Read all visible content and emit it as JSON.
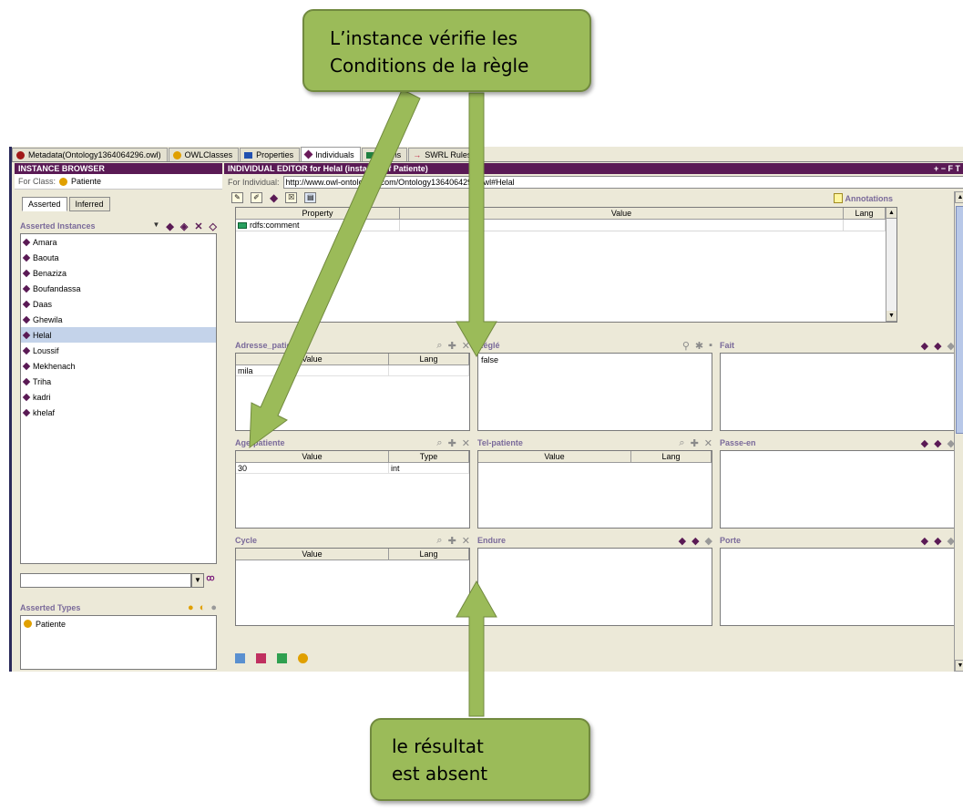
{
  "tabs": [
    {
      "label": "Metadata(Ontology1364064296.owl)",
      "color": "#a01818",
      "shape": "dot"
    },
    {
      "label": "OWLClasses",
      "color": "#e0a000",
      "shape": "dot"
    },
    {
      "label": "Properties",
      "color": "#2050b0",
      "shape": "square"
    },
    {
      "label": "Individuals",
      "color": "#5a1a55",
      "shape": "diamond",
      "active": true
    },
    {
      "label": "Forms",
      "color": "#208040",
      "shape": "square"
    },
    {
      "label": "SWRL Rules",
      "color": "#c02040",
      "shape": "arrow"
    }
  ],
  "instance_browser": {
    "title": "INSTANCE BROWSER",
    "for_class_label": "For Class:",
    "for_class_value": "Patiente",
    "subtabs": [
      "Asserted",
      "Inferred"
    ],
    "asserted_instances_label": "Asserted Instances",
    "instances": [
      "Amara",
      "Baouta",
      "Benaziza",
      "Boufandassa",
      "Daas",
      "Ghewila",
      "Helal",
      "Loussif",
      "Mekhenach",
      "Triha",
      "kadri",
      "khelaf"
    ],
    "selected_instance": "Helal",
    "asserted_types_label": "Asserted Types",
    "types": [
      "Patiente"
    ]
  },
  "editor": {
    "title": "INDIVIDUAL EDITOR for Helal  (instance of Patiente)",
    "title_controls": "+ − F T",
    "for_individual_label": "For Individual:",
    "for_individual_value": "http://www.owl-ontologies.com/Ontology1364064296.owl#Helal",
    "annotations_label": "Annotations",
    "prop_headers": [
      "Property",
      "Value",
      "Lang"
    ],
    "prop_rows": [
      {
        "property": "rdfs:comment",
        "value": "",
        "lang": ""
      }
    ]
  },
  "props": {
    "adresse": {
      "name": "Adresse_patiente",
      "headers": [
        "Value",
        "Lang"
      ],
      "rows": [
        [
          "mila",
          ""
        ]
      ]
    },
    "regle": {
      "name": "Réglé",
      "value": "false"
    },
    "fait": {
      "name": "Fait"
    },
    "age": {
      "name": "Age-patiente",
      "headers": [
        "Value",
        "Type"
      ],
      "rows": [
        [
          "30",
          "int"
        ]
      ]
    },
    "tel": {
      "name": "Tel-patiente",
      "headers": [
        "Value",
        "Lang"
      ]
    },
    "passe": {
      "name": "Passe-en"
    },
    "cycle": {
      "name": "Cycle",
      "headers": [
        "Value",
        "Lang"
      ]
    },
    "endure": {
      "name": "Endure"
    },
    "porte": {
      "name": "Porte"
    }
  },
  "callouts": {
    "top_line1": "L’instance vérifie les",
    "top_line2": "Conditions de la règle",
    "bottom_line1": "le résultat",
    "bottom_line2": "est absent"
  },
  "colors": {
    "title_bar": "#5a1a55",
    "callout_fill": "#9bbb59",
    "selection": "#c4d3ea"
  }
}
